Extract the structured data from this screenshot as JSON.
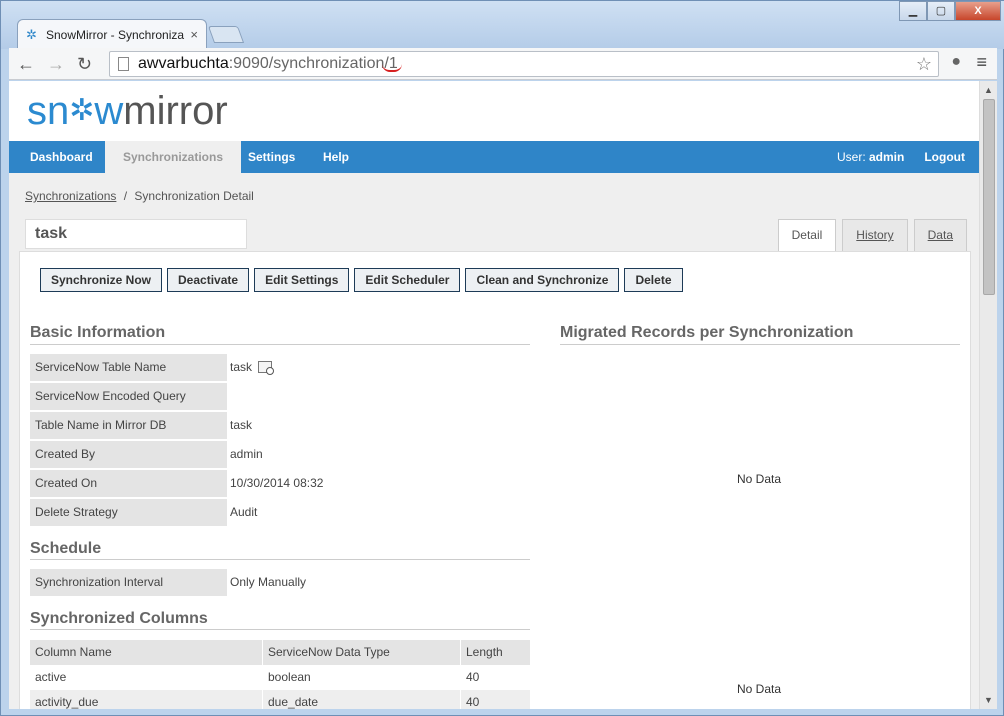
{
  "browser": {
    "tab_title": "SnowMirror - Synchroniza",
    "tab_close": "×",
    "url_host": "awvarbuchta",
    "url_path": ":9090/synchronization/1",
    "window_buttons": [
      "▁",
      "▢",
      "X"
    ]
  },
  "app": {
    "logo_left": "sn",
    "logo_flake": "✲",
    "logo_w": "w",
    "logo_right": "mirror"
  },
  "nav": {
    "items": [
      "Dashboard",
      "Synchronizations",
      "Settings",
      "Help"
    ],
    "active": "Synchronizations",
    "user_label": "User:",
    "user_name": "admin",
    "logout": "Logout"
  },
  "breadcrumb": {
    "link": "Synchronizations",
    "separator": "/",
    "current": "Synchronization Detail"
  },
  "task_name": "task",
  "page_tabs": [
    "Detail",
    "History",
    "Data"
  ],
  "actions": [
    "Synchronize Now",
    "Deactivate",
    "Edit Settings",
    "Edit Scheduler",
    "Clean and Synchronize",
    "Delete"
  ],
  "basic_info": {
    "title": "Basic Information",
    "rows": [
      {
        "label": "ServiceNow Table Name",
        "value": "task"
      },
      {
        "label": "ServiceNow Encoded Query",
        "value": ""
      },
      {
        "label": "Table Name in Mirror DB",
        "value": "task"
      },
      {
        "label": "Created By",
        "value": "admin"
      },
      {
        "label": "Created On",
        "value": "10/30/2014 08:32"
      },
      {
        "label": "Delete Strategy",
        "value": "Audit"
      }
    ]
  },
  "schedule": {
    "title": "Schedule",
    "rows": [
      {
        "label": "Synchronization Interval",
        "value": "Only Manually"
      }
    ]
  },
  "columns": {
    "title": "Synchronized Columns",
    "headers": [
      "Column Name",
      "ServiceNow Data Type",
      "Length"
    ],
    "rows": [
      [
        "active",
        "boolean",
        "40"
      ],
      [
        "activity_due",
        "due_date",
        "40"
      ]
    ]
  },
  "migrated": {
    "title": "Migrated Records per Synchronization",
    "no_data_1": "No Data",
    "no_data_2": "No Data"
  },
  "colors": {
    "nav_bg": "#2f85c8",
    "logo_blue": "#2b8ad0"
  }
}
